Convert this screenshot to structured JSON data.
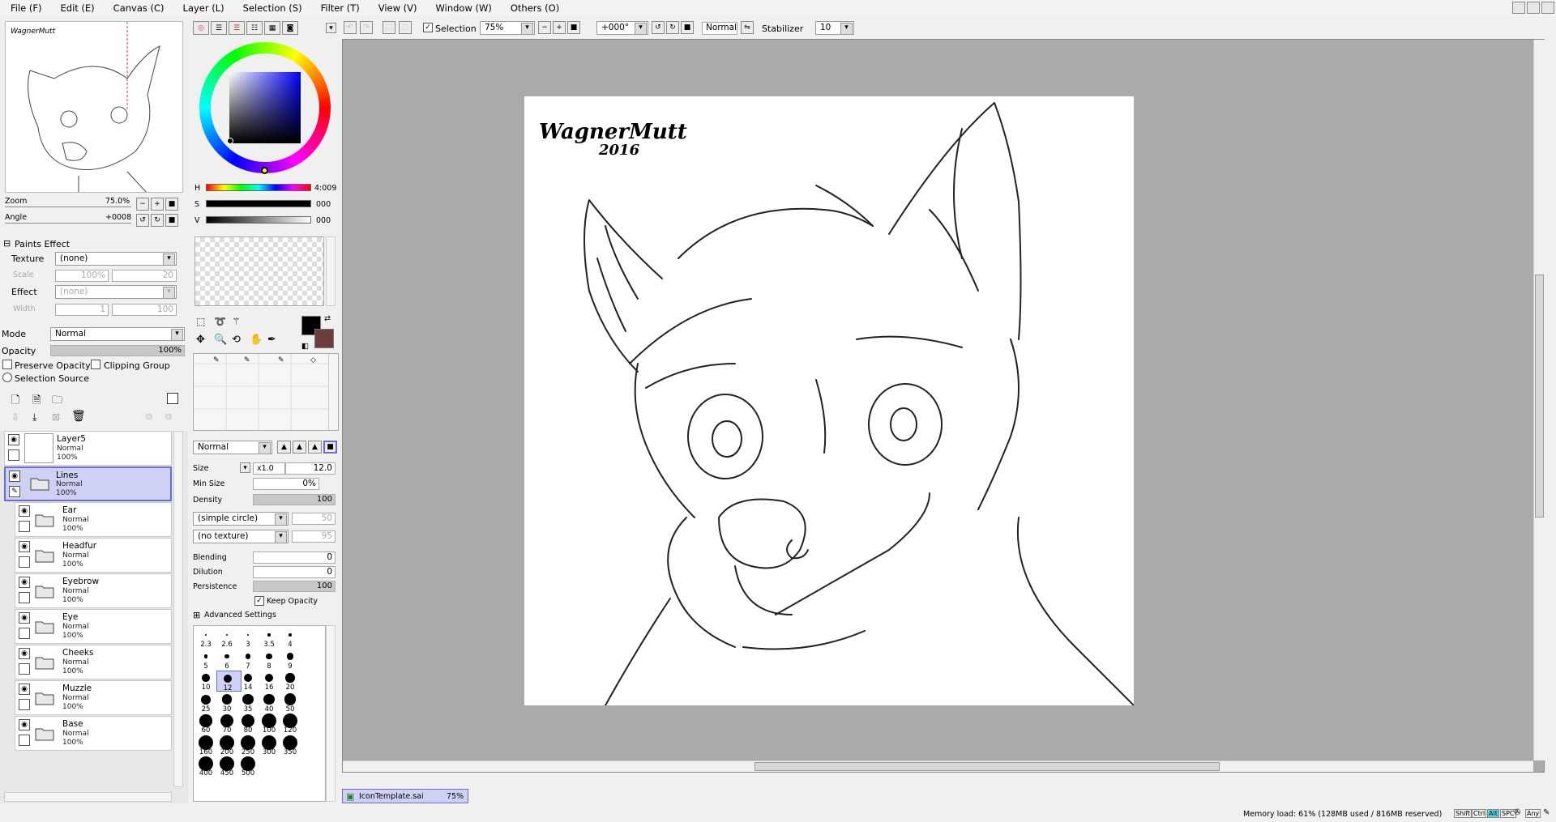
{
  "menu": [
    "File (F)",
    "Edit (E)",
    "Canvas (C)",
    "Layer (L)",
    "Selection (S)",
    "Filter (T)",
    "View (V)",
    "Window (W)",
    "Others (O)"
  ],
  "navigator": {
    "zoom_label": "Zoom",
    "zoom_value": "75.0%",
    "angle_label": "Angle",
    "angle_value": "+0008"
  },
  "paints_effect": {
    "title": "Paints Effect",
    "texture_label": "Texture",
    "texture_value": "(none)",
    "scale_label": "Scale",
    "scale_value": "100%",
    "scale_num": "20",
    "effect_label": "Effect",
    "effect_value": "(none)",
    "width_label": "Width",
    "width_value": "1",
    "width_num": "100"
  },
  "layer_props": {
    "mode_label": "Mode",
    "mode_value": "Normal",
    "opacity_label": "Opacity",
    "opacity_value": "100%",
    "preserve": "Preserve Opacity",
    "clipping": "Clipping Group",
    "selsource": "Selection Source"
  },
  "layers": [
    {
      "name": "Layer5",
      "mode": "Normal",
      "opacity": "100%"
    },
    {
      "name": "Lines",
      "mode": "Normal",
      "opacity": "100%"
    },
    {
      "name": "Ear",
      "mode": "Normal",
      "opacity": "100%"
    },
    {
      "name": "Headfur",
      "mode": "Normal",
      "opacity": "100%"
    },
    {
      "name": "Eyebrow",
      "mode": "Normal",
      "opacity": "100%"
    },
    {
      "name": "Eye",
      "mode": "Normal",
      "opacity": "100%"
    },
    {
      "name": "Cheeks",
      "mode": "Normal",
      "opacity": "100%"
    },
    {
      "name": "Muzzle",
      "mode": "Normal",
      "opacity": "100%"
    },
    {
      "name": "Base",
      "mode": "Normal",
      "opacity": "100%"
    }
  ],
  "color": {
    "h_label": "H",
    "h_value": "4:009",
    "s_label": "S",
    "s_value": "000",
    "v_label": "V",
    "v_value": "000",
    "primary": "#000000",
    "secondary": "#6b3d3d"
  },
  "brush": {
    "mode_value": "Normal",
    "size_label": "Size",
    "size_mult": "x1.0",
    "size_value": "12.0",
    "minsize_label": "Min Size",
    "minsize_value": "0%",
    "density_label": "Density",
    "density_value": "100",
    "shape": "(simple circle)",
    "shape_num": "50",
    "texture": "(no texture)",
    "texture_num": "95",
    "blending_label": "Blending",
    "blending_value": "0",
    "dilution_label": "Dilution",
    "dilution_value": "0",
    "persistence_label": "Persistence",
    "persistence_value": "100",
    "keep_opacity": "Keep Opacity",
    "advanced": "Advanced Settings"
  },
  "brush_sizes": [
    "2.3",
    "2.6",
    "3",
    "3.5",
    "4",
    "5",
    "6",
    "7",
    "8",
    "9",
    "10",
    "12",
    "14",
    "16",
    "20",
    "25",
    "30",
    "35",
    "40",
    "50",
    "60",
    "70",
    "80",
    "100",
    "120",
    "160",
    "200",
    "250",
    "300",
    "350",
    "400",
    "450",
    "500"
  ],
  "toolbar": {
    "selection_label": "Selection",
    "zoom_value": "75%",
    "angle_value": "+000°",
    "blend_value": "Normal",
    "stabilizer_label": "Stabilizer",
    "stabilizer_value": "10"
  },
  "document": {
    "tab_name": "IconTemplate.sai",
    "tab_zoom": "75%",
    "signature_name": "WagnerMutt",
    "signature_year": "2016"
  },
  "status": {
    "memory": "Memory load: 61% (128MB used / 816MB reserved)",
    "keys": [
      "Shift",
      "Ctrl",
      "Alt",
      "SPC",
      "Any"
    ]
  }
}
